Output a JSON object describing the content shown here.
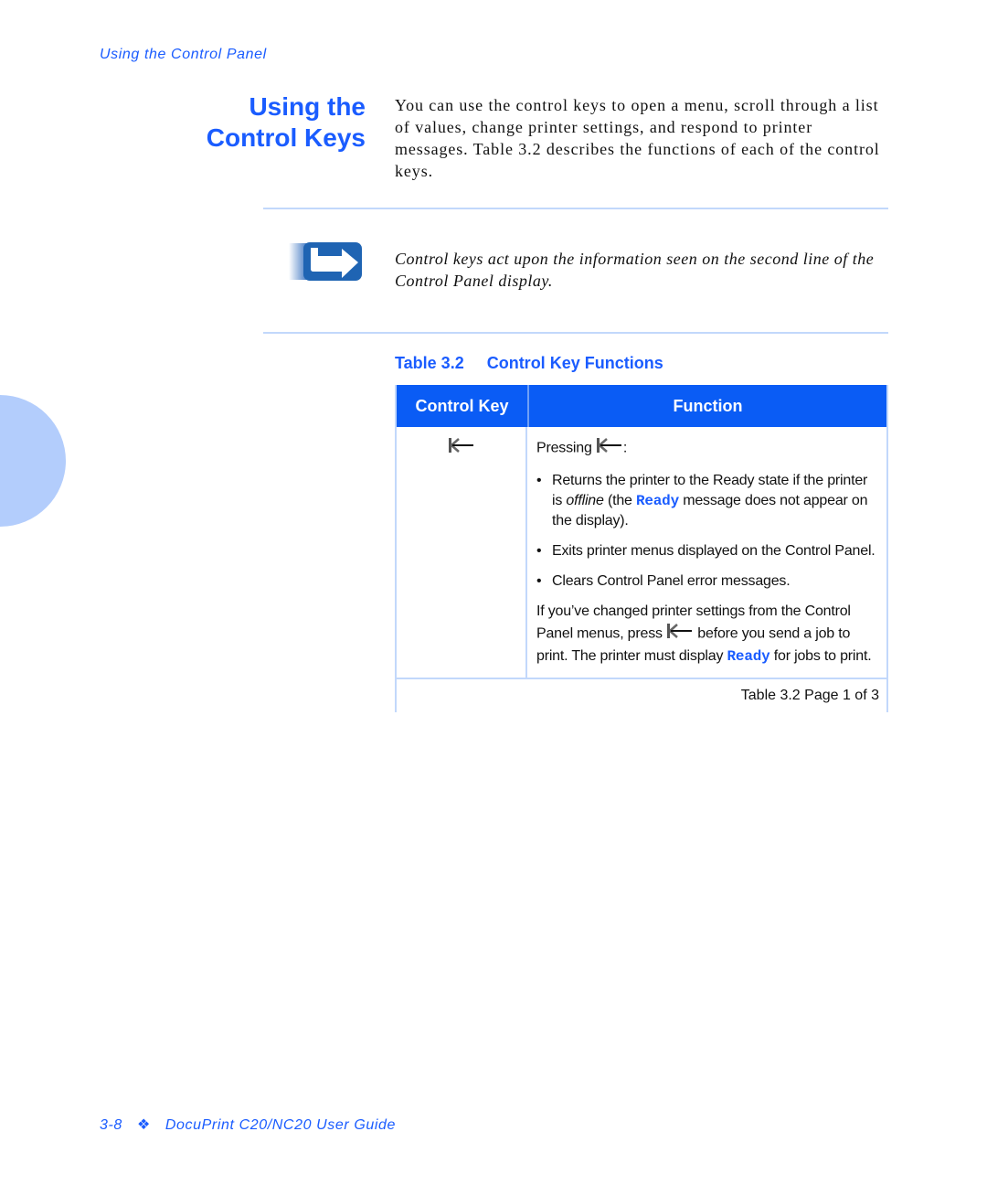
{
  "running_head": "Using the Control Panel",
  "section": {
    "title_line1": "Using the",
    "title_line2": "Control Keys",
    "intro": "You can use the control keys to open a menu, scroll through a list of values, change printer settings, and respond to printer messages. Table 3.2 describes the functions of each of the control keys."
  },
  "note": {
    "icon": "note-arrow-icon",
    "text": "Control keys act upon the information seen on the second line of the Control Panel display."
  },
  "table": {
    "caption_number": "Table 3.2",
    "caption_title": "Control Key Functions",
    "headers": [
      "Control Key",
      "Function"
    ],
    "rows": [
      {
        "key_icon": "exit-key-icon",
        "pressing_prefix": "Pressing",
        "pressing_suffix": ":",
        "bullets": [
          {
            "before": "Returns the printer to the Ready state if the printer is ",
            "emphasis": "offline",
            "middle": " (the ",
            "code": "Ready",
            "after": " message does not appear on the display)."
          },
          {
            "text": "Exits printer menus displayed on the Control Panel."
          },
          {
            "text": "Clears Control Panel error messages."
          }
        ],
        "closing": {
          "before": "If you’ve changed printer settings from the Control Panel menus, press ",
          "after": " before you send a job to print. The printer must display ",
          "code": "Ready",
          "end": " for jobs to print."
        }
      }
    ],
    "footer": "Table 3.2  Page 1 of 3"
  },
  "footer": {
    "page": "3-8",
    "separator": "❖",
    "title": "DocuPrint C20/NC20 User Guide"
  },
  "colors": {
    "accent": "#1a5cff",
    "table_header": "#0a5cf5",
    "rule": "#c2d8fb",
    "tab_circle": "#b3cdfc"
  }
}
